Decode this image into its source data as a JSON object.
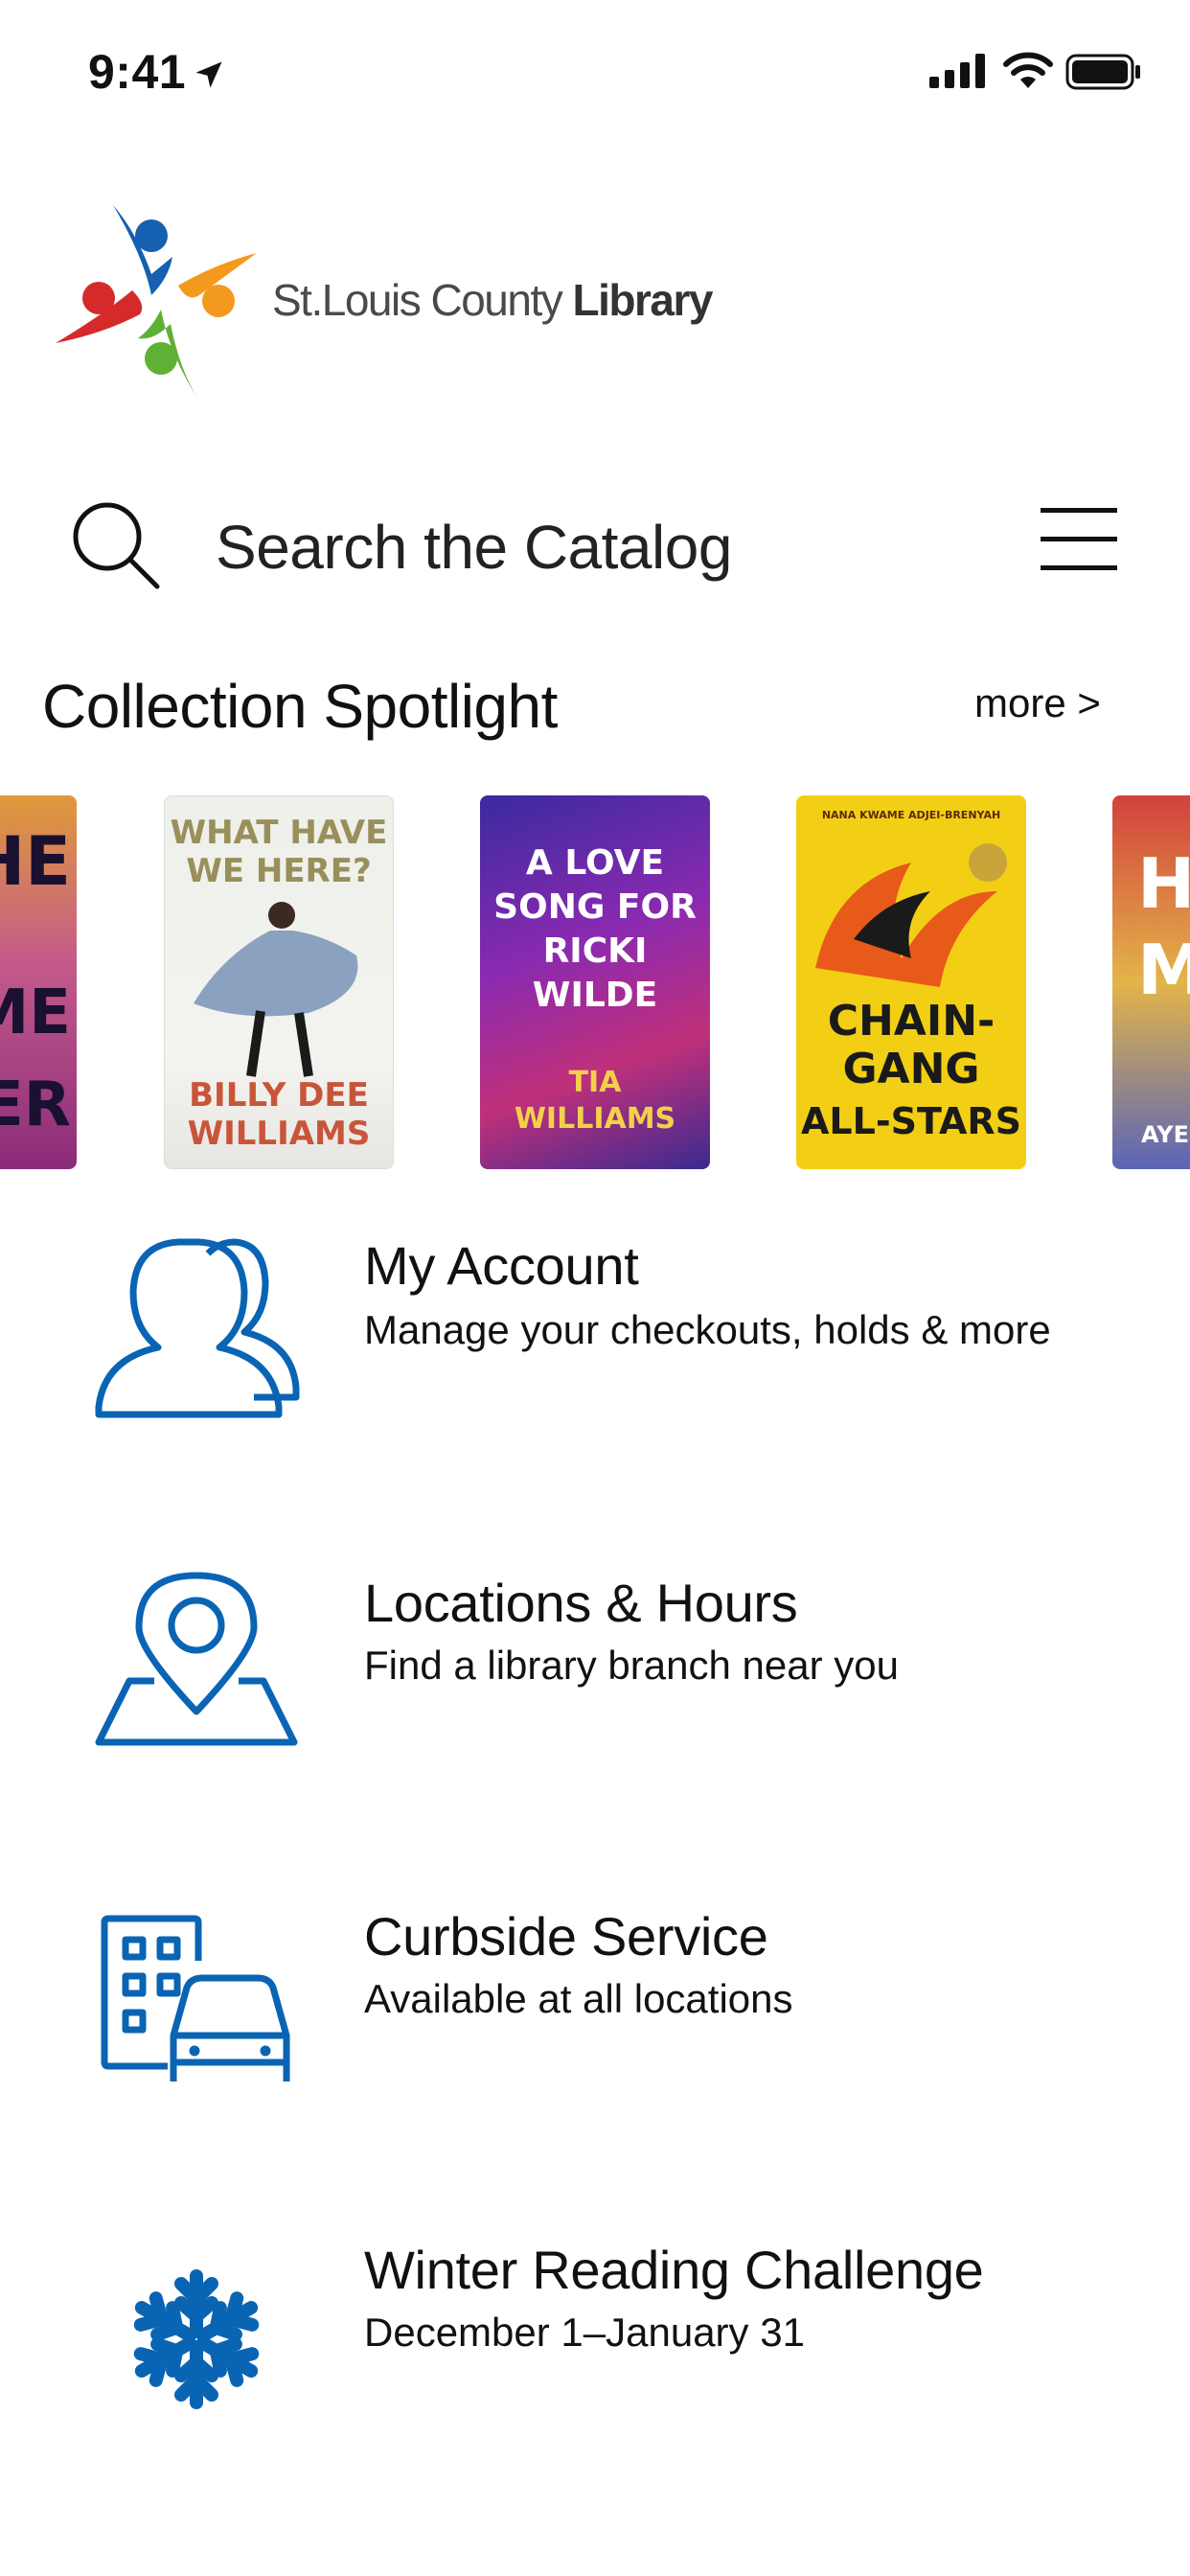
{
  "status_bar": {
    "time": "9:41",
    "icons": [
      "location-arrow-icon",
      "cellular-signal-icon",
      "wifi-icon",
      "battery-icon"
    ]
  },
  "logo": {
    "text_regular": "St.Louis County ",
    "text_bold": "Library"
  },
  "search": {
    "placeholder": "Search the Catalog",
    "icon": "search-icon"
  },
  "header": {
    "menu_icon": "hamburger-menu-icon"
  },
  "spotlight": {
    "title": "Collection Spotlight",
    "more_label": "more >",
    "books": [
      {
        "cover_lines": [
          "THE",
          "AME",
          "IDER"
        ]
      },
      {
        "cover_lines": [
          "WHAT HAVE",
          "WE HERE?",
          "BILLY DEE",
          "WILLIAMS"
        ]
      },
      {
        "cover_lines": [
          "A LOVE",
          "SONG FOR",
          "RICKI",
          "WILDE",
          "TIA",
          "WILLIAMS"
        ]
      },
      {
        "cover_lines": [
          "NANA KWAME ADJEI-BRENYAH",
          "CHAIN-",
          "GANG",
          "ALL-STARS"
        ]
      },
      {
        "cover_lines": [
          "H",
          "M",
          "AYES"
        ]
      }
    ]
  },
  "menu": [
    {
      "title": "My Account",
      "subtitle": "Manage your checkouts, holds & more",
      "icon": "account-users-icon"
    },
    {
      "title": "Locations & Hours",
      "subtitle": "Find a library branch near you",
      "icon": "map-pin-icon"
    },
    {
      "title": "Curbside Service",
      "subtitle": "Available at all locations",
      "icon": "building-car-icon"
    },
    {
      "title": "Winter Reading Challenge",
      "subtitle": "December 1–January 31",
      "icon": "snowflake-icon"
    }
  ],
  "colors": {
    "accent_blue": "#0a64b4",
    "text": "#111111"
  }
}
